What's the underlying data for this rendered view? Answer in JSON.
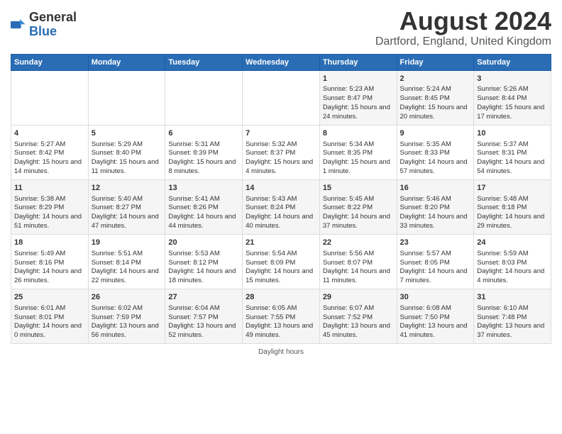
{
  "logo": {
    "general": "General",
    "blue": "Blue"
  },
  "header": {
    "month_year": "August 2024",
    "location": "Dartford, England, United Kingdom"
  },
  "days_of_week": [
    "Sunday",
    "Monday",
    "Tuesday",
    "Wednesday",
    "Thursday",
    "Friday",
    "Saturday"
  ],
  "weeks": [
    [
      {
        "day": "",
        "content": ""
      },
      {
        "day": "",
        "content": ""
      },
      {
        "day": "",
        "content": ""
      },
      {
        "day": "",
        "content": ""
      },
      {
        "day": "1",
        "content": "Sunrise: 5:23 AM\nSunset: 8:47 PM\nDaylight: 15 hours and 24 minutes."
      },
      {
        "day": "2",
        "content": "Sunrise: 5:24 AM\nSunset: 8:45 PM\nDaylight: 15 hours and 20 minutes."
      },
      {
        "day": "3",
        "content": "Sunrise: 5:26 AM\nSunset: 8:44 PM\nDaylight: 15 hours and 17 minutes."
      }
    ],
    [
      {
        "day": "4",
        "content": "Sunrise: 5:27 AM\nSunset: 8:42 PM\nDaylight: 15 hours and 14 minutes."
      },
      {
        "day": "5",
        "content": "Sunrise: 5:29 AM\nSunset: 8:40 PM\nDaylight: 15 hours and 11 minutes."
      },
      {
        "day": "6",
        "content": "Sunrise: 5:31 AM\nSunset: 8:39 PM\nDaylight: 15 hours and 8 minutes."
      },
      {
        "day": "7",
        "content": "Sunrise: 5:32 AM\nSunset: 8:37 PM\nDaylight: 15 hours and 4 minutes."
      },
      {
        "day": "8",
        "content": "Sunrise: 5:34 AM\nSunset: 8:35 PM\nDaylight: 15 hours and 1 minute."
      },
      {
        "day": "9",
        "content": "Sunrise: 5:35 AM\nSunset: 8:33 PM\nDaylight: 14 hours and 57 minutes."
      },
      {
        "day": "10",
        "content": "Sunrise: 5:37 AM\nSunset: 8:31 PM\nDaylight: 14 hours and 54 minutes."
      }
    ],
    [
      {
        "day": "11",
        "content": "Sunrise: 5:38 AM\nSunset: 8:29 PM\nDaylight: 14 hours and 51 minutes."
      },
      {
        "day": "12",
        "content": "Sunrise: 5:40 AM\nSunset: 8:27 PM\nDaylight: 14 hours and 47 minutes."
      },
      {
        "day": "13",
        "content": "Sunrise: 5:41 AM\nSunset: 8:26 PM\nDaylight: 14 hours and 44 minutes."
      },
      {
        "day": "14",
        "content": "Sunrise: 5:43 AM\nSunset: 8:24 PM\nDaylight: 14 hours and 40 minutes."
      },
      {
        "day": "15",
        "content": "Sunrise: 5:45 AM\nSunset: 8:22 PM\nDaylight: 14 hours and 37 minutes."
      },
      {
        "day": "16",
        "content": "Sunrise: 5:46 AM\nSunset: 8:20 PM\nDaylight: 14 hours and 33 minutes."
      },
      {
        "day": "17",
        "content": "Sunrise: 5:48 AM\nSunset: 8:18 PM\nDaylight: 14 hours and 29 minutes."
      }
    ],
    [
      {
        "day": "18",
        "content": "Sunrise: 5:49 AM\nSunset: 8:16 PM\nDaylight: 14 hours and 26 minutes."
      },
      {
        "day": "19",
        "content": "Sunrise: 5:51 AM\nSunset: 8:14 PM\nDaylight: 14 hours and 22 minutes."
      },
      {
        "day": "20",
        "content": "Sunrise: 5:53 AM\nSunset: 8:12 PM\nDaylight: 14 hours and 18 minutes."
      },
      {
        "day": "21",
        "content": "Sunrise: 5:54 AM\nSunset: 8:09 PM\nDaylight: 14 hours and 15 minutes."
      },
      {
        "day": "22",
        "content": "Sunrise: 5:56 AM\nSunset: 8:07 PM\nDaylight: 14 hours and 11 minutes."
      },
      {
        "day": "23",
        "content": "Sunrise: 5:57 AM\nSunset: 8:05 PM\nDaylight: 14 hours and 7 minutes."
      },
      {
        "day": "24",
        "content": "Sunrise: 5:59 AM\nSunset: 8:03 PM\nDaylight: 14 hours and 4 minutes."
      }
    ],
    [
      {
        "day": "25",
        "content": "Sunrise: 6:01 AM\nSunset: 8:01 PM\nDaylight: 14 hours and 0 minutes."
      },
      {
        "day": "26",
        "content": "Sunrise: 6:02 AM\nSunset: 7:59 PM\nDaylight: 13 hours and 56 minutes."
      },
      {
        "day": "27",
        "content": "Sunrise: 6:04 AM\nSunset: 7:57 PM\nDaylight: 13 hours and 52 minutes."
      },
      {
        "day": "28",
        "content": "Sunrise: 6:05 AM\nSunset: 7:55 PM\nDaylight: 13 hours and 49 minutes."
      },
      {
        "day": "29",
        "content": "Sunrise: 6:07 AM\nSunset: 7:52 PM\nDaylight: 13 hours and 45 minutes."
      },
      {
        "day": "30",
        "content": "Sunrise: 6:08 AM\nSunset: 7:50 PM\nDaylight: 13 hours and 41 minutes."
      },
      {
        "day": "31",
        "content": "Sunrise: 6:10 AM\nSunset: 7:48 PM\nDaylight: 13 hours and 37 minutes."
      }
    ]
  ],
  "footer": {
    "text": "Daylight hours"
  }
}
